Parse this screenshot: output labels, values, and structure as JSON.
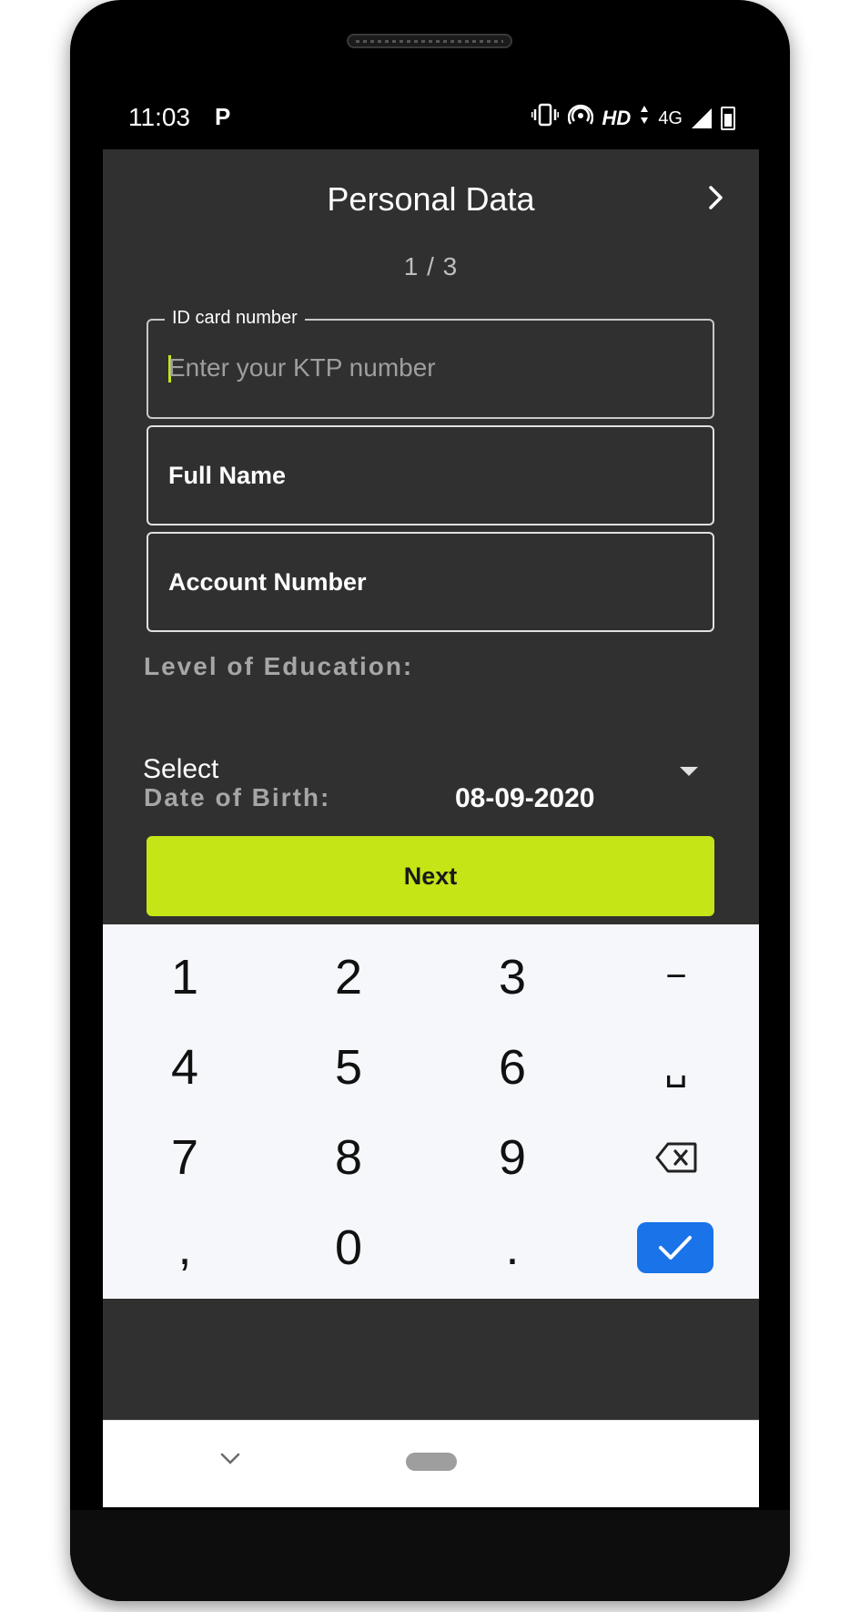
{
  "status_bar": {
    "time": "11:03",
    "app_icon": "P",
    "network_hd": "HD",
    "network_type": "4G",
    "icons": [
      "vibrate-icon",
      "hotspot-icon",
      "hd-icon",
      "data-arrows-icon",
      "signal-icon",
      "battery-charging-icon"
    ]
  },
  "header": {
    "title": "Personal Data",
    "next_icon": "chevron-right-icon"
  },
  "step_indicator": "1 / 3",
  "form": {
    "id_card": {
      "label": "ID card number",
      "placeholder": "Enter your KTP number"
    },
    "full_name": {
      "label": "Full Name"
    },
    "account_number": {
      "label": "Account Number"
    },
    "education": {
      "label": "Level of Education:",
      "selected": "Select"
    },
    "dob": {
      "label": "Date of Birth:",
      "value": "08-09-2020"
    },
    "next_button": "Next"
  },
  "keyboard": {
    "row1": [
      "1",
      "2",
      "3",
      "−"
    ],
    "row2": [
      "4",
      "5",
      "6",
      "␣"
    ],
    "row3": [
      "7",
      "8",
      "9"
    ],
    "row4": [
      ",",
      "0",
      "."
    ],
    "backspace_icon": "backspace-icon",
    "done_icon": "check-icon"
  },
  "colors": {
    "accent": "#c5e516",
    "background": "#303030",
    "keyboard_bg": "#f5f7fa",
    "done_key": "#1a73e8"
  }
}
